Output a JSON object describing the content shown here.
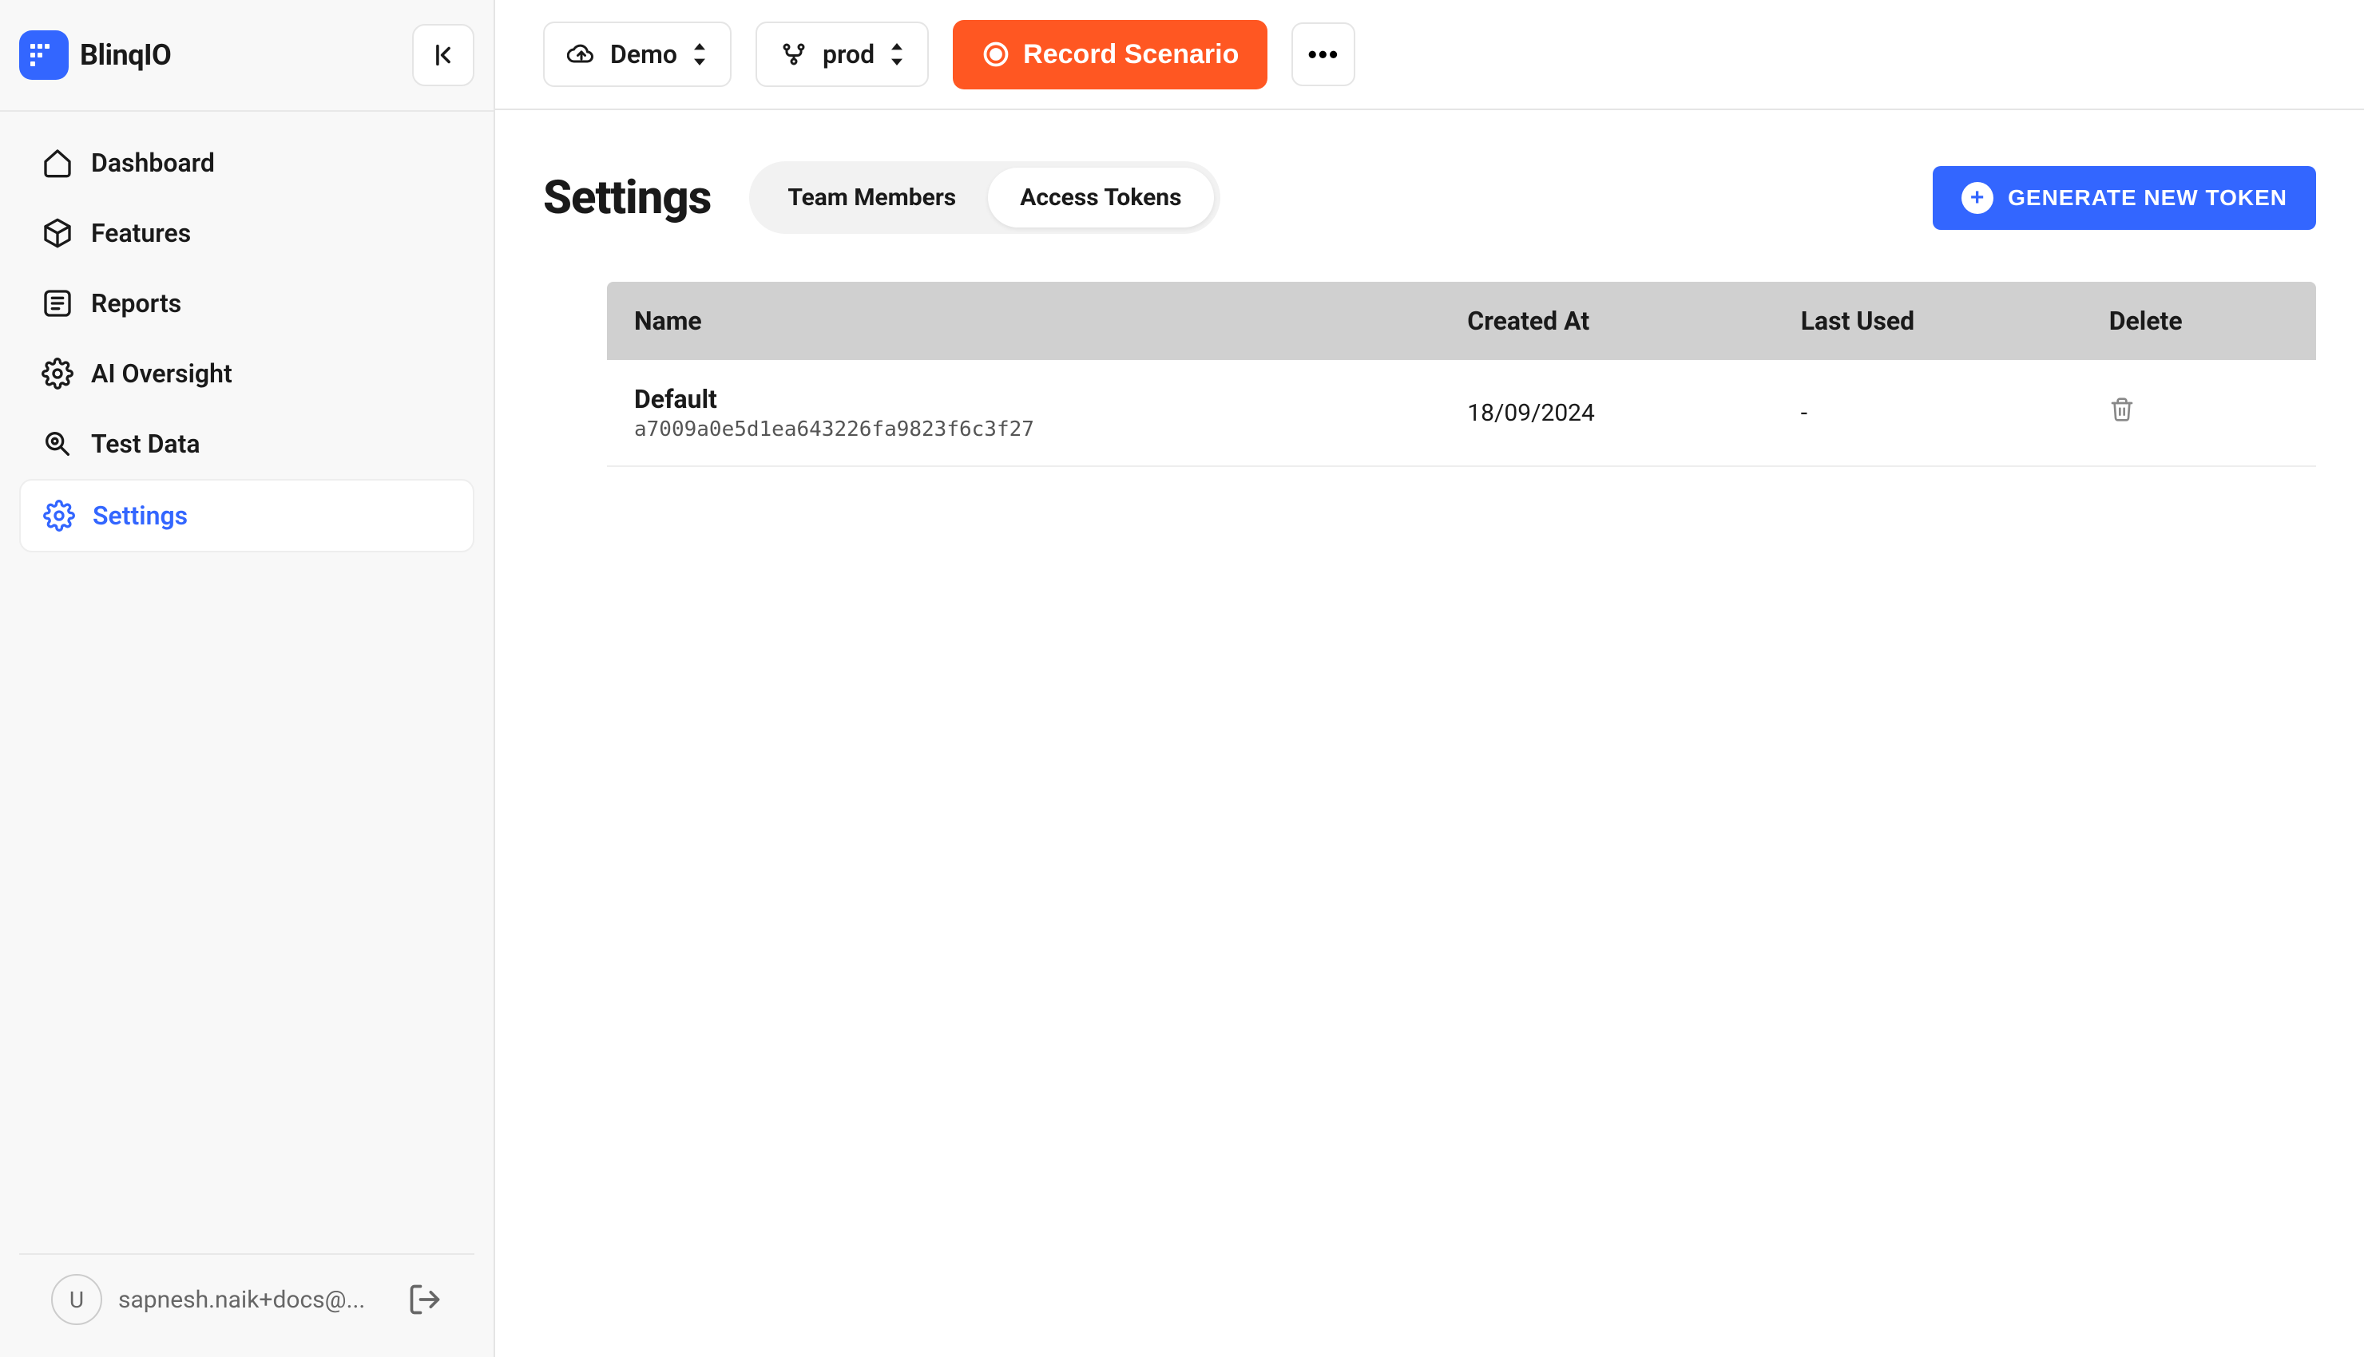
{
  "brand": {
    "name": "BlinqIO",
    "badge": "•••"
  },
  "sidebar": {
    "items": [
      {
        "label": "Dashboard",
        "icon": "home"
      },
      {
        "label": "Features",
        "icon": "cube"
      },
      {
        "label": "Reports",
        "icon": "list"
      },
      {
        "label": "AI Oversight",
        "icon": "gear"
      },
      {
        "label": "Test Data",
        "icon": "search-gear"
      },
      {
        "label": "Settings",
        "icon": "settings",
        "active": true
      }
    ]
  },
  "user": {
    "initial": "U",
    "email": "sapnesh.naik+docs@..."
  },
  "topbar": {
    "project_label": "Demo",
    "env_label": "prod",
    "record_label": "Record Scenario"
  },
  "page": {
    "title": "Settings",
    "tabs": [
      {
        "label": "Team Members",
        "active": false
      },
      {
        "label": "Access Tokens",
        "active": true
      }
    ],
    "generate_label": "GENERATE NEW TOKEN"
  },
  "table": {
    "columns": [
      "Name",
      "Created At",
      "Last Used",
      "Delete"
    ],
    "rows": [
      {
        "name": "Default",
        "hash": "a7009a0e5d1ea643226fa9823f6c3f27",
        "created_at": "18/09/2024",
        "last_used": "-"
      }
    ]
  }
}
